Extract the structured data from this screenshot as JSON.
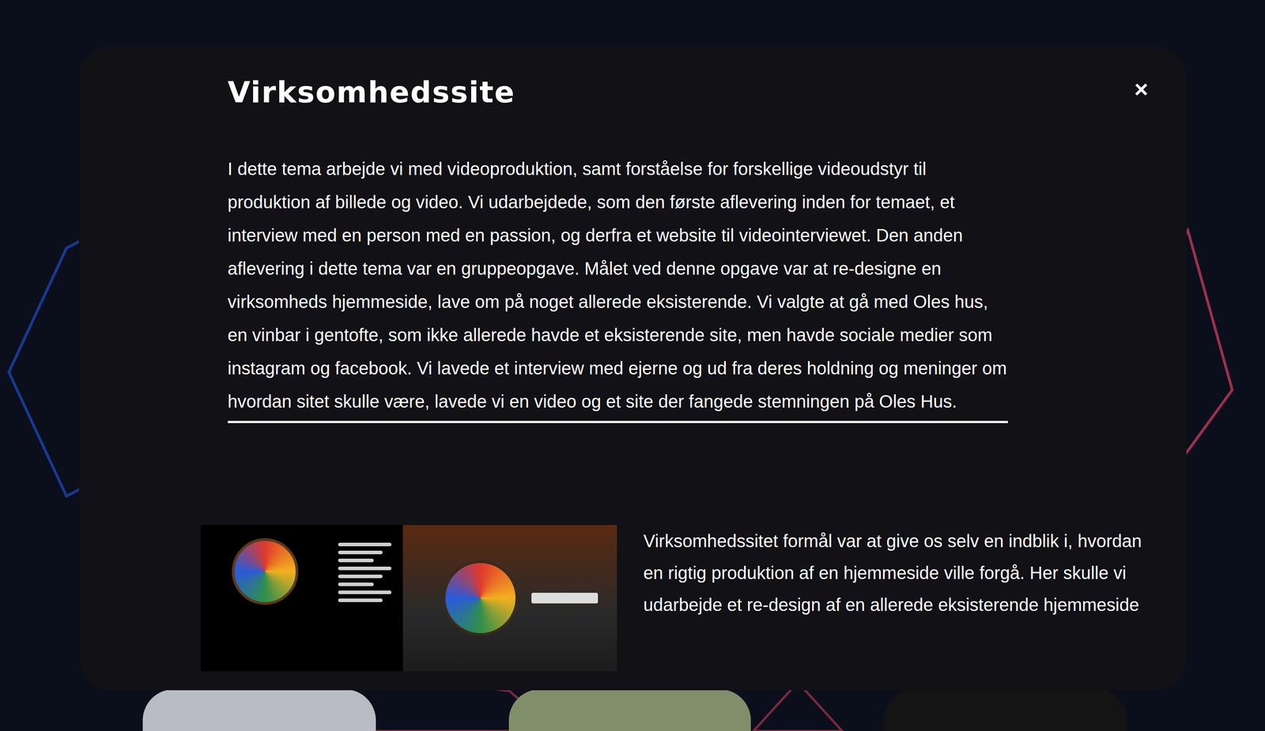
{
  "modal": {
    "title": "Virksomhedssite",
    "close": "×",
    "intro": "I dette tema arbejde vi med videoproduktion, samt forståelse for forskellige videoudstyr til produktion af billede og video. Vi udarbejdede, som den første aflevering inden for temaet, et interview med en person med en passion, og derfra et website til videointerviewet. Den anden aflevering i dette tema var en gruppeopgave. Målet ved denne opgave var at re-designe en virksomheds hjemmeside, lave om på noget allerede eksisterende. Vi valgte at gå med Oles hus, en vinbar i gentofte, som ikke allerede havde et eksisterende site, men havde sociale medier som instagram og facebook. Vi lavede et interview med ejerne og ud fra deres holdning og meninger om hvordan sitet skulle være, lavede vi en video og et site der fangede stemningen på Oles Hus.",
    "section_text": "Virksomhedssitet formål var at give os selv en indblik i, hvordan en rigtig produktion af en hjemmeside ville forgå. Her skulle vi udarbejde et re-design af en allerede eksisterende hjemmeside"
  }
}
